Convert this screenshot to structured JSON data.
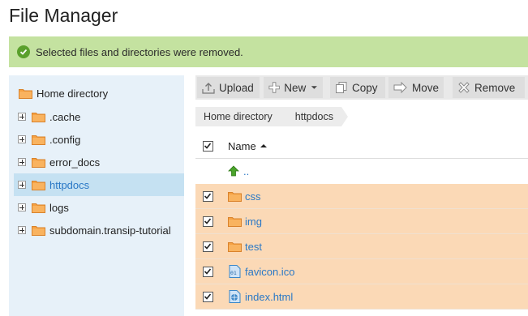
{
  "window": {
    "title": "File Manager"
  },
  "banner": {
    "message": "Selected files and directories were removed.",
    "color": "#c4e2a0"
  },
  "sidebar": {
    "root": "Home directory",
    "items": [
      {
        "label": ".cache",
        "selected": false
      },
      {
        "label": ".config",
        "selected": false
      },
      {
        "label": "error_docs",
        "selected": false
      },
      {
        "label": "httpdocs",
        "selected": true
      },
      {
        "label": "logs",
        "selected": false
      },
      {
        "label": "subdomain.transip-tutorial",
        "selected": false
      }
    ]
  },
  "toolbar": {
    "upload": "Upload",
    "new": "New",
    "copy": "Copy",
    "move": "Move",
    "remove": "Remove"
  },
  "breadcrumb": [
    "Home directory",
    "httpdocs"
  ],
  "table": {
    "header": {
      "name": "Name",
      "sort": "ascending"
    },
    "parent": "..",
    "rows": [
      {
        "name": "css",
        "type": "folder",
        "checked": true
      },
      {
        "name": "img",
        "type": "folder",
        "checked": true
      },
      {
        "name": "test",
        "type": "folder",
        "checked": true
      },
      {
        "name": "favicon.ico",
        "type": "binary-file",
        "checked": true
      },
      {
        "name": "index.html",
        "type": "html-file",
        "checked": true
      }
    ]
  },
  "colors": {
    "accent": "#2a78c6",
    "selection": "#fbd9b6",
    "sidebar": "#e7f1f9",
    "folder": "#f5a142"
  }
}
